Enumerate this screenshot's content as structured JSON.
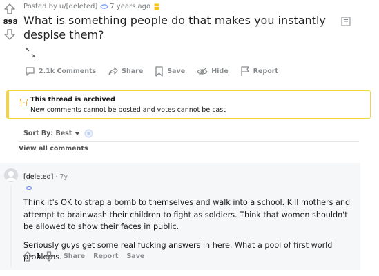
{
  "post": {
    "score": "898",
    "posted_by_prefix": "Posted by",
    "author": "u/[deleted]",
    "age": "7 years ago",
    "title": "What is something people do that makes you instantly despise them?"
  },
  "actions": {
    "comments": "2.1k Comments",
    "share": "Share",
    "save": "Save",
    "hide": "Hide",
    "report": "Report"
  },
  "archived": {
    "title": "This thread is archived",
    "subtitle": "New comments cannot be posted and votes cannot be cast"
  },
  "sort": {
    "label": "Sort By: Best"
  },
  "view_all": "View all comments",
  "comment": {
    "author": "[deleted]",
    "dot": "·",
    "age": "7y",
    "paragraphs": [
      "Think it's OK to strap a bomb to themselves and walk into a school. Kill mothers and attempt to brainwash their children to fight as soldiers. Think that women shouldn't be allowed to show their faces in public.",
      "Seriously guys get some real fucking answers in here. What a pool of first world problems."
    ],
    "score": "1",
    "share": "Share",
    "report": "Report",
    "save": "Save"
  },
  "colors": {
    "archived_border": "#f7d33d",
    "award_blue": "#7193ff",
    "award_gold": "#f5c518",
    "muted": "#878a8c"
  },
  "icons": {
    "upvote": "upvote-arrow-icon",
    "downvote": "downvote-arrow-icon",
    "award": "award-icon",
    "gold": "gold-award-icon",
    "document": "document-icon",
    "expand": "expand-icon",
    "comment": "comment-bubble-icon",
    "share": "share-arrow-icon",
    "save": "bookmark-icon",
    "hide": "eye-slash-icon",
    "report": "flag-icon",
    "archive": "archive-box-icon",
    "caret": "caret-down-icon",
    "avatar": "avatar-icon"
  }
}
